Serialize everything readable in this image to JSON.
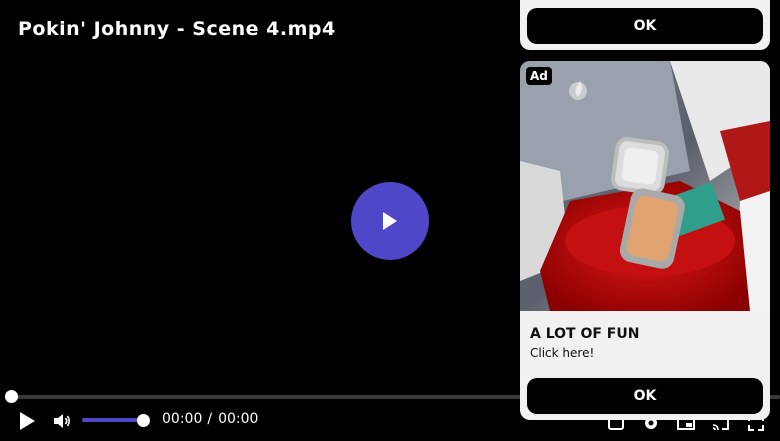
{
  "video": {
    "title": "Pokin' Johnny - Scene 4.mp4",
    "current_time": "00:00",
    "separator": "/",
    "duration": "00:00",
    "progress_fraction": 0,
    "volume_fraction": 1
  },
  "ad_top": {
    "ok_label": "OK"
  },
  "ad_card": {
    "badge": "Ad",
    "headline": "A LOT OF FUN",
    "subtext": "Click here!",
    "ok_label": "OK"
  },
  "colors": {
    "accent": "#4f46c8",
    "background": "#000000",
    "card": "#f1f1f1"
  },
  "icons": [
    "play-icon",
    "volume-icon",
    "settings-icon",
    "pip-icon",
    "cast-icon",
    "fullscreen-icon",
    "big-play-icon"
  ]
}
